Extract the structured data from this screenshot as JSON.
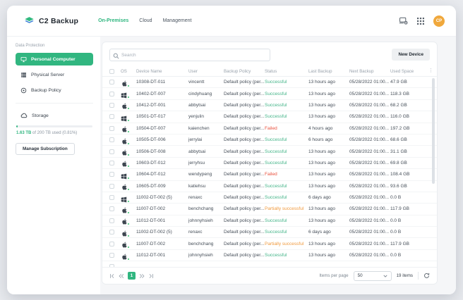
{
  "topbar": {
    "brand": "C2 Backup",
    "nav": [
      {
        "label": "On-Premises",
        "active": true
      },
      {
        "label": "Cloud",
        "active": false
      },
      {
        "label": "Management",
        "active": false
      }
    ],
    "avatar_initials": "CP"
  },
  "sidebar": {
    "section_label": "Data Protection",
    "items": [
      {
        "label": "Personal Computer",
        "icon": "desktop-icon",
        "active": true
      },
      {
        "label": "Physical Server",
        "icon": "server-icon",
        "active": false
      },
      {
        "label": "Backup Policy",
        "icon": "policy-icon",
        "active": false
      }
    ],
    "storage": {
      "label": "Storage",
      "used_label": "1.63 TB",
      "usage_rest": " of 200 TB used (0.81%)",
      "used_percent": 0.81,
      "manage_button": "Manage Subscription"
    }
  },
  "toolbar": {
    "search_placeholder": "Search",
    "new_device_label": "New Device"
  },
  "table": {
    "columns": [
      "OS",
      "Device Name",
      "User",
      "Backup Policy",
      "Status",
      "Last Backup",
      "Next Backup",
      "Used Space"
    ],
    "rows": [
      {
        "os": "apple",
        "device": "10308-DT-011",
        "user": "vincentt",
        "policy": "Default policy (per...",
        "status": "Successful",
        "status_type": "success",
        "last_backup": "13 hours ago",
        "next_backup": "05/28/2022 01:00...",
        "used_space": "47.9 GB"
      },
      {
        "os": "windows",
        "device": "10402-DT-007",
        "user": "cindyhuang",
        "policy": "Default policy (per...",
        "status": "Successful",
        "status_type": "success",
        "last_backup": "13 hours ago",
        "next_backup": "05/28/2022 01:00...",
        "used_space": "118.3 GB"
      },
      {
        "os": "apple",
        "device": "10412-DT-001",
        "user": "abbytsai",
        "policy": "Default policy (per...",
        "status": "Successful",
        "status_type": "success",
        "last_backup": "13 hours ago",
        "next_backup": "05/28/2022 01:00...",
        "used_space": "68.2 GB"
      },
      {
        "os": "windows",
        "device": "10501-DT-017",
        "user": "yenjulin",
        "policy": "Default policy (per...",
        "status": "Successful",
        "status_type": "success",
        "last_backup": "13 hours ago",
        "next_backup": "05/28/2022 01:00...",
        "used_space": "116.0 GB"
      },
      {
        "os": "apple",
        "device": "10504-DT-007",
        "user": "kaienchen",
        "policy": "Default policy (per...",
        "status": "Failed",
        "status_type": "failed",
        "last_backup": "4 hours ago",
        "next_backup": "05/28/2022 01:00...",
        "used_space": "197.2 GB"
      },
      {
        "os": "apple",
        "device": "10505-DT-006",
        "user": "jerrylai",
        "policy": "Default policy (per...",
        "status": "Successful",
        "status_type": "success",
        "last_backup": "6 hours ago",
        "next_backup": "05/28/2022 01:00...",
        "used_space": "68.6 GB"
      },
      {
        "os": "apple",
        "device": "10506-DT-008",
        "user": "abbytsai",
        "policy": "Default policy (per...",
        "status": "Successful",
        "status_type": "success",
        "last_backup": "13 hours ago",
        "next_backup": "05/28/2022 01:00...",
        "used_space": "31.1 GB"
      },
      {
        "os": "apple",
        "device": "10603-DT-012",
        "user": "jerryhsu",
        "policy": "Default policy (per...",
        "status": "Successful",
        "status_type": "success",
        "last_backup": "13 hours ago",
        "next_backup": "05/28/2022 01:00...",
        "used_space": "69.8 GB"
      },
      {
        "os": "windows",
        "device": "10604-DT-012",
        "user": "wendypeng",
        "policy": "Default policy (per...",
        "status": "Failed",
        "status_type": "failed",
        "last_backup": "13 hours ago",
        "next_backup": "05/28/2022 01:00...",
        "used_space": "108.4 GB"
      },
      {
        "os": "apple",
        "device": "10605-DT-009",
        "user": "katiehsu",
        "policy": "Default policy (per...",
        "status": "Successful",
        "status_type": "success",
        "last_backup": "13 hours ago",
        "next_backup": "05/28/2022 01:00...",
        "used_space": "93.6 GB"
      },
      {
        "os": "windows",
        "device": "11002-DT-002 (5)",
        "user": "renaxc",
        "policy": "Default policy (per...",
        "status": "Successful",
        "status_type": "success",
        "last_backup": "6 days ago",
        "next_backup": "05/28/2022 01:00...",
        "used_space": "0.0 B"
      },
      {
        "os": "apple",
        "device": "11007-DT-002",
        "user": "benchchang",
        "policy": "Default policy (per...",
        "status": "Partially successful",
        "status_type": "partial",
        "last_backup": "13 hours ago",
        "next_backup": "05/28/2022 01:00...",
        "used_space": "117.9 GB"
      },
      {
        "os": "apple",
        "device": "11012-DT-001",
        "user": "johnnyhsieh",
        "policy": "Default policy (per...",
        "status": "Successful",
        "status_type": "success",
        "last_backup": "13 hours ago",
        "next_backup": "05/28/2022 01:00...",
        "used_space": "0.0 B"
      },
      {
        "os": "apple",
        "device": "11002-DT-002 (5)",
        "user": "renaxc",
        "policy": "Default policy (per...",
        "status": "Successful",
        "status_type": "success",
        "last_backup": "6 days ago",
        "next_backup": "05/28/2022 01:00...",
        "used_space": "0.0 B"
      },
      {
        "os": "apple",
        "device": "11007-DT-002",
        "user": "benchchang",
        "policy": "Default policy (per...",
        "status": "Partially successful",
        "status_type": "partial",
        "last_backup": "13 hours ago",
        "next_backup": "05/28/2022 01:00...",
        "used_space": "117.9 GB"
      },
      {
        "os": "apple",
        "device": "11012-DT-001",
        "user": "johnnyhsieh",
        "policy": "Default policy (per...",
        "status": "Successful",
        "status_type": "success",
        "last_backup": "13 hours ago",
        "next_backup": "05/28/2022 01:00...",
        "used_space": "0.0 B"
      }
    ]
  },
  "pagination": {
    "current_page": "1",
    "items_per_page_label": "Items per page",
    "per_page_value": "50",
    "items_count": "19 items"
  },
  "colors": {
    "accent_green": "#31b680",
    "success_text": "#43b488",
    "failed_text": "#e8513d",
    "partial_text": "#f09a3e",
    "avatar_bg": "#f0a83c"
  }
}
